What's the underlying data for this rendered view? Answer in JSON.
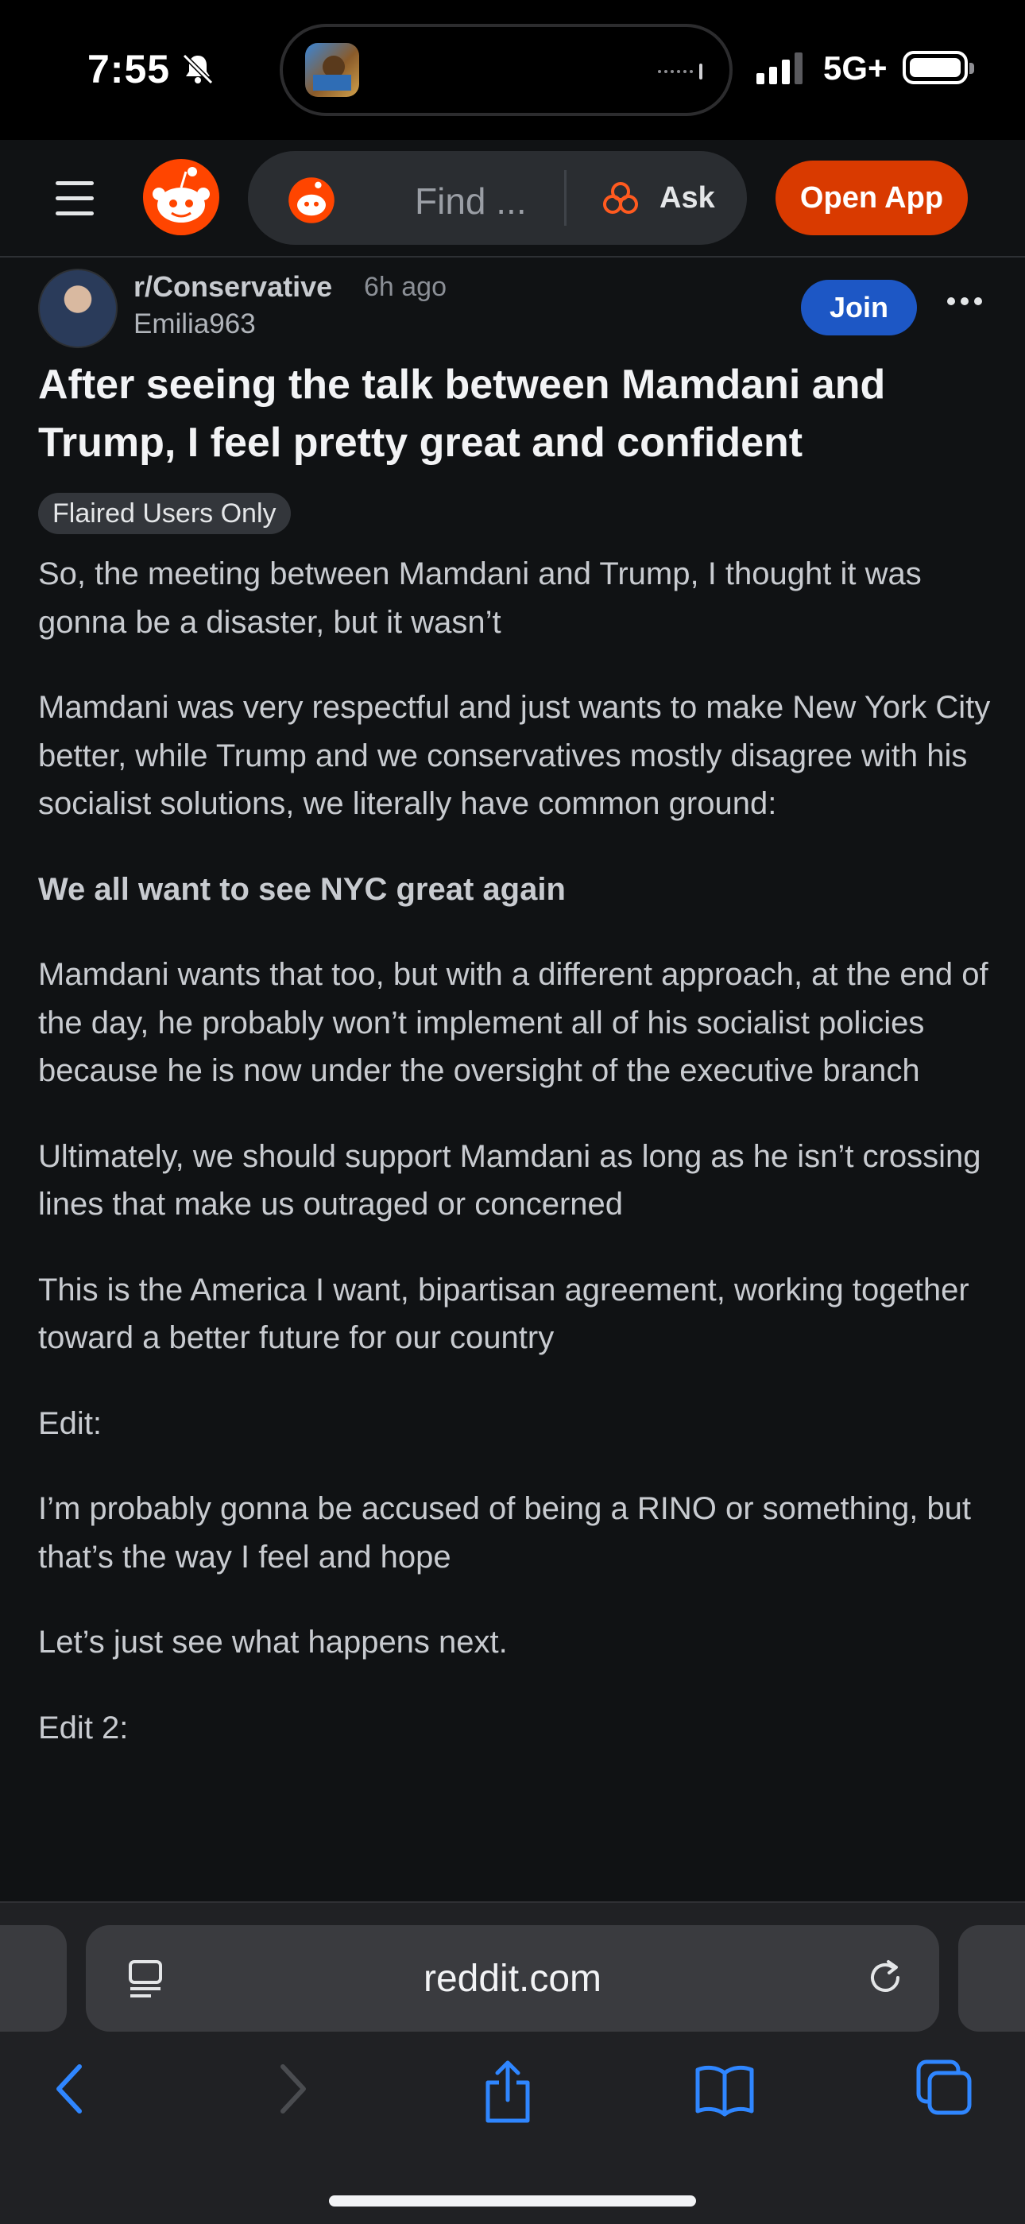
{
  "status_bar": {
    "time": "7:55",
    "network": "5G+"
  },
  "header": {
    "search_placeholder": "Find ...",
    "ask_label": "Ask",
    "open_app_label": "Open App"
  },
  "post": {
    "subreddit": "r/Conservative",
    "time_ago": "6h ago",
    "author": "Emilia963",
    "join_label": "Join",
    "title": "After seeing the talk between Mamdani and Trump, I feel pretty great and confident",
    "flair": "Flaired Users Only",
    "paragraphs": [
      "So, the meeting between Mamdani and Trump, I thought it was gonna be a disaster, but it wasn’t",
      "Mamdani was very respectful and just wants to make New York City better, while Trump and we conservatives mostly disagree with his socialist solutions, we literally have common ground:",
      "We all want to see NYC great again",
      "Mamdani wants that too, but with a different approach, at the end of the day, he probably won’t implement all of his socialist policies because he is now under the oversight of the executive branch",
      "Ultimately, we should support Mamdani as long as he isn’t crossing lines that make us outraged or concerned",
      "This is the America I want, bipartisan agreement, working together toward a better future for our country",
      "Edit:",
      "I’m probably gonna be accused of being a RINO or something, but that’s the way I feel and hope",
      "Let’s just see what happens next.",
      "Edit 2:"
    ]
  },
  "safari": {
    "url": "reddit.com"
  },
  "colors": {
    "accent_orange": "#d93a00",
    "join_blue": "#1d57c5",
    "background": "#101214"
  }
}
